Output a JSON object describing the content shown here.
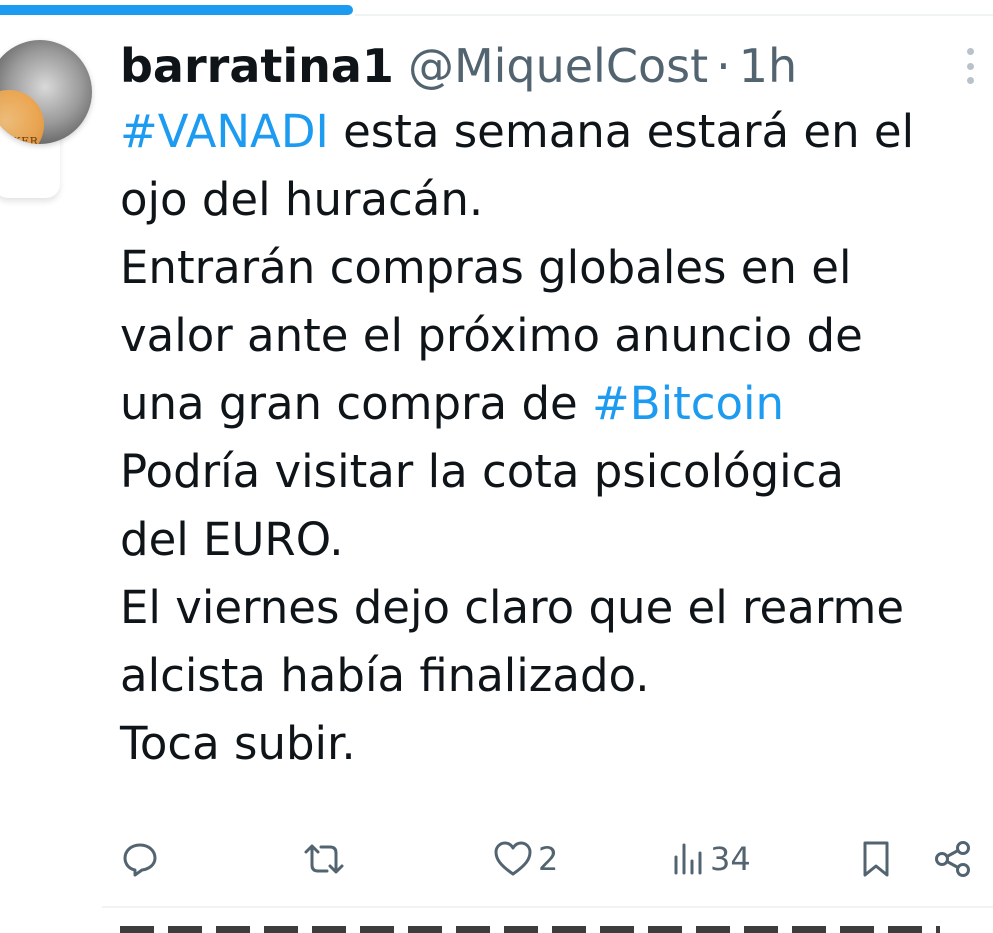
{
  "progress": {
    "fraction": 0.355
  },
  "tweet": {
    "author_name": "barratina1",
    "handle": "@MiquelCost",
    "separator": "·",
    "time": "1h",
    "avatar_text": "JOKER",
    "lines": [
      {
        "hashtag": "#VANADI",
        "text": " esta semana estará en el"
      },
      {
        "text": "ojo del huracán."
      },
      {
        "text": "Entrarán compras globales en el"
      },
      {
        "text": "valor ante el próximo anuncio de"
      },
      {
        "text": "una gran compra de ",
        "hashtag": "#Bitcoin"
      },
      {
        "text": "Podría visitar la cota psicológica"
      },
      {
        "text": "del EURO."
      },
      {
        "text": "El viernes dejo claro que el rearme"
      },
      {
        "text": "alcista había finalizado."
      },
      {
        "text": "Toca subir."
      }
    ],
    "actions": {
      "reply_icon": "reply-icon",
      "retweet_icon": "retweet-icon",
      "like_icon": "heart-icon",
      "like_count": "2",
      "views_icon": "views-icon",
      "views_count": "34",
      "bookmark_icon": "bookmark-icon",
      "share_icon": "share-icon"
    }
  },
  "colors": {
    "accent": "#1d9bf0",
    "text": "#0f1419",
    "muted": "#536471"
  }
}
